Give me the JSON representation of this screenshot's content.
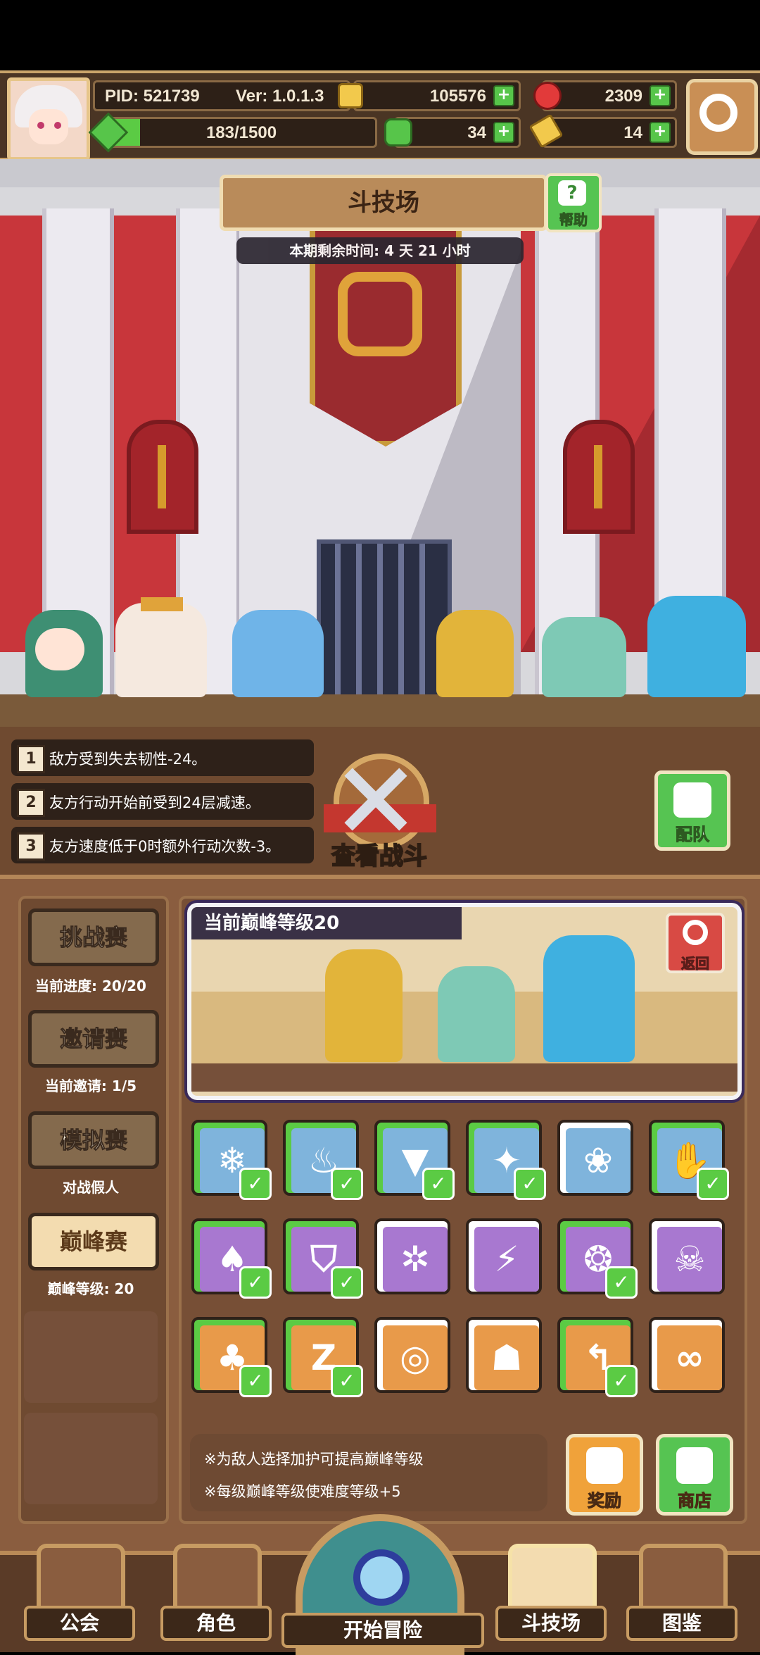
{
  "topbar": {
    "pid": "PID: 521739",
    "version": "Ver: 1.0.1.3",
    "energy": "183/1500",
    "energy_fill": 0.12,
    "gold": "105576",
    "gems": "2309",
    "clover": "34",
    "keys": "14"
  },
  "arena": {
    "title": "斗技场",
    "help_label": "帮助",
    "timer": "本期剩余时间: 4 天 21 小时"
  },
  "effects": [
    {
      "num": "1",
      "text": "敌方受到失去韧性-24。"
    },
    {
      "num": "2",
      "text": "友方行动开始前受到24层减速。"
    },
    {
      "num": "3",
      "text": "友方速度低于0时额外行动次数-3。"
    }
  ],
  "battle": {
    "view_label": "查看战斗",
    "team_label": "配队"
  },
  "modes": [
    {
      "label": "挑战赛",
      "sub": "当前进度: 20/20",
      "active": false
    },
    {
      "label": "邀请赛",
      "sub": "当前邀请: 1/5",
      "active": false
    },
    {
      "label": "模拟赛",
      "sub": "对战假人",
      "active": false
    },
    {
      "label": "巅峰赛",
      "sub": "巅峰等级: 20",
      "active": true
    }
  ],
  "preview": {
    "level": "当前巅峰等级20",
    "back_label": "返回"
  },
  "tiles": [
    {
      "icon": "snowflake-icon",
      "sym": "❄",
      "color": "#7fb4dc",
      "border": "#5bcb44",
      "checked": true
    },
    {
      "icon": "flame-icon",
      "sym": "♨",
      "color": "#7fb4dc",
      "border": "#5bcb44",
      "checked": true
    },
    {
      "icon": "funnel-icon",
      "sym": "▼",
      "color": "#7fb4dc",
      "border": "#5bcb44",
      "checked": true
    },
    {
      "icon": "sparkle-icon",
      "sym": "✦",
      "color": "#7fb4dc",
      "border": "#5bcb44",
      "checked": true
    },
    {
      "icon": "paw-icon",
      "sym": "❀",
      "color": "#7fb4dc",
      "border": "#ffffff",
      "checked": false
    },
    {
      "icon": "claw-icon",
      "sym": "✋",
      "color": "#7fb4dc",
      "border": "#5bcb44",
      "checked": true
    },
    {
      "icon": "mushroom-icon",
      "sym": "♠",
      "color": "#a878d0",
      "border": "#5bcb44",
      "checked": true
    },
    {
      "icon": "shield-icon",
      "sym": "⛉",
      "color": "#a878d0",
      "border": "#5bcb44",
      "checked": true
    },
    {
      "icon": "burst-icon",
      "sym": "✲",
      "color": "#a878d0",
      "border": "#ffffff",
      "checked": false
    },
    {
      "icon": "lightning-icon",
      "sym": "⚡",
      "color": "#a878d0",
      "border": "#ffffff",
      "checked": false
    },
    {
      "icon": "ring-icon",
      "sym": "❂",
      "color": "#a878d0",
      "border": "#5bcb44",
      "checked": true
    },
    {
      "icon": "skull-icon",
      "sym": "☠",
      "color": "#a878d0",
      "border": "#ffffff",
      "checked": false
    },
    {
      "icon": "shell-icon",
      "sym": "♣",
      "color": "#e89a4a",
      "border": "#5bcb44",
      "checked": true
    },
    {
      "icon": "sleep-icon",
      "sym": "Z",
      "color": "#e89a4a",
      "border": "#5bcb44",
      "checked": true
    },
    {
      "icon": "wave-icon",
      "sym": "◎",
      "color": "#e89a4a",
      "border": "#ffffff",
      "checked": false
    },
    {
      "icon": "ghost-icon",
      "sym": "☗",
      "color": "#e89a4a",
      "border": "#ffffff",
      "checked": false
    },
    {
      "icon": "cane-icon",
      "sym": "↰",
      "color": "#e89a4a",
      "border": "#5bcb44",
      "checked": true
    },
    {
      "icon": "infinity-icon",
      "sym": "∞",
      "color": "#e89a4a",
      "border": "#ffffff",
      "checked": false
    }
  ],
  "notes": [
    "※为敌人选择加护可提高巅峰等级",
    "※每级巅峰等级使难度等级+5"
  ],
  "buttons": {
    "reward_label": "奖励",
    "shop_label": "商店"
  },
  "nav": [
    {
      "label": "公会",
      "icon": "guild-house-icon"
    },
    {
      "label": "角色",
      "icon": "character-icon"
    },
    {
      "label": "开始冒险",
      "icon": "world-map-icon"
    },
    {
      "label": "斗技场",
      "icon": "crossed-swords-icon"
    },
    {
      "label": "图鉴",
      "icon": "codex-book-icon"
    }
  ]
}
